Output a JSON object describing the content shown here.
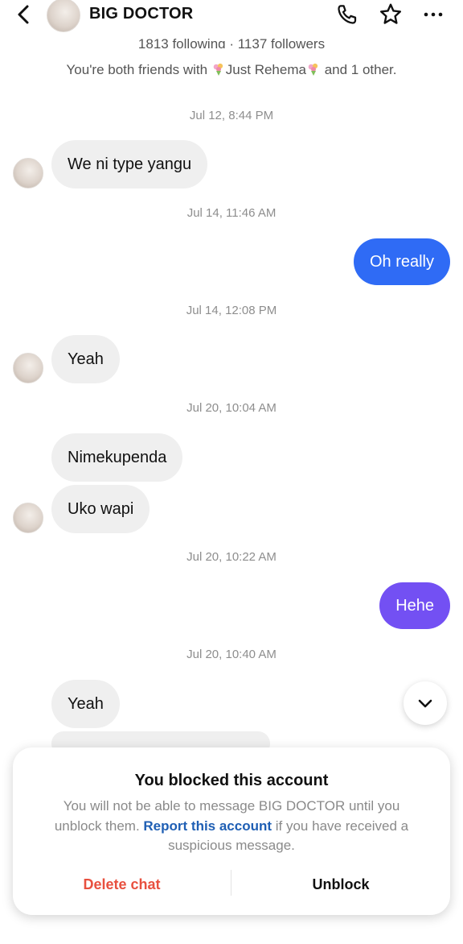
{
  "header": {
    "contact_name": "BIG DOCTOR",
    "icons": [
      "back-icon",
      "phone-icon",
      "star-icon",
      "more-icon"
    ]
  },
  "profile": {
    "stats": "1813 following · 1137 followers",
    "mutual_prefix": "You're both friends with ",
    "mutual_name": "Just  Rehema",
    "mutual_suffix": " and 1 other."
  },
  "messages": [
    {
      "type": "timestamp",
      "text": "Jul 12, 8:44 PM"
    },
    {
      "type": "incoming",
      "text": "We ni type yangu"
    },
    {
      "type": "timestamp",
      "text": "Jul 14, 11:46 AM"
    },
    {
      "type": "outgoing",
      "text": "Oh really",
      "color": "#2f6bf5"
    },
    {
      "type": "timestamp",
      "text": "Jul 14, 12:08 PM"
    },
    {
      "type": "incoming",
      "text": "Yeah"
    },
    {
      "type": "timestamp",
      "text": "Jul 20, 10:04 AM"
    },
    {
      "type": "incoming",
      "text": "Nimekupenda"
    },
    {
      "type": "incoming",
      "text": "Uko wapi"
    },
    {
      "type": "timestamp",
      "text": "Jul 20, 10:22 AM"
    },
    {
      "type": "outgoing",
      "text": "Hehe",
      "color": "#7350f3"
    },
    {
      "type": "timestamp",
      "text": "Jul 20, 10:40 AM"
    },
    {
      "type": "incoming",
      "text": "Yeah"
    }
  ],
  "blocked_notice": {
    "title": "You blocked this account",
    "desc_before": "You will not be able to message BIG DOCTOR until you unblock them. ",
    "report_link": "Report this account",
    "desc_after": " if you have received a suspicious message.",
    "delete_label": "Delete chat",
    "unblock_label": "Unblock"
  },
  "colors": {
    "accent_blue": "#2f6bf5",
    "accent_purple": "#7350f3",
    "danger": "#e8503f",
    "link": "#1f5fb4"
  }
}
